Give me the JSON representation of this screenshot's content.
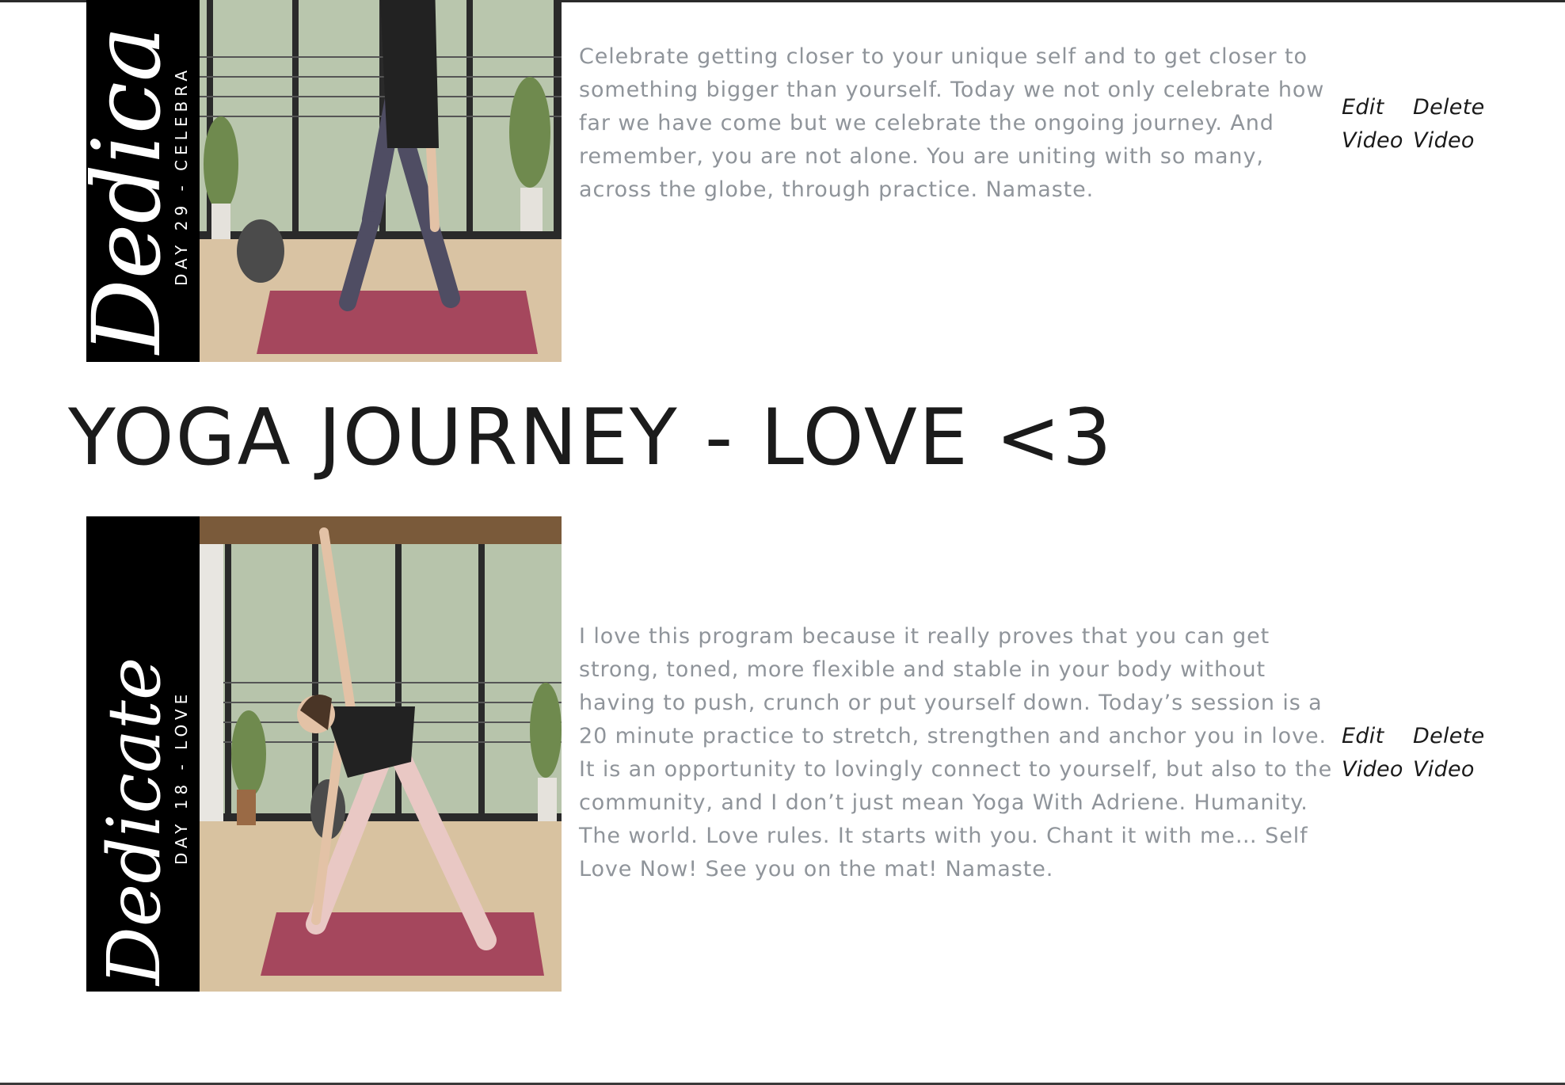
{
  "videos": [
    {
      "thumbnail": {
        "script": "Dedica",
        "caption": "DAY 29 - CELEBRA"
      },
      "description": "Celebrate getting closer to your unique self and to get closer to something bigger than yourself. Today we not only celebrate how far we have come but we celebrate the ongoing journey. And remember, you are not alone. You are uniting with so many, across the globe, through practice. Namaste.",
      "edit_label": "Edit Video",
      "delete_label": "Delete Video"
    },
    {
      "thumbnail": {
        "script": "Dedicate",
        "caption": "DAY 18 - LOVE"
      },
      "description": "I love this program because it really proves that you can get strong, toned, more flexible and stable in your body without having to push, crunch or put yourself down. Today’s session is a 20 minute practice to stretch, strengthen and anchor you in love. It is an opportunity to lovingly connect to yourself, but also to the community, and I don’t just mean Yoga With Adriene. Humanity. The world. Love rules. It starts with you. Chant it with me… Self Love Now! See you on the mat! Namaste.",
      "edit_label": "Edit Video",
      "delete_label": "Delete Video"
    }
  ],
  "section": {
    "title": "YOGA JOURNEY - LOVE <3"
  },
  "colors": {
    "description_text": "#8f949a",
    "title_text": "#1b1b1b",
    "action_text": "#1a1a1a",
    "thumbnail_band": "#000000",
    "yoga_mat": "#a5475d"
  }
}
